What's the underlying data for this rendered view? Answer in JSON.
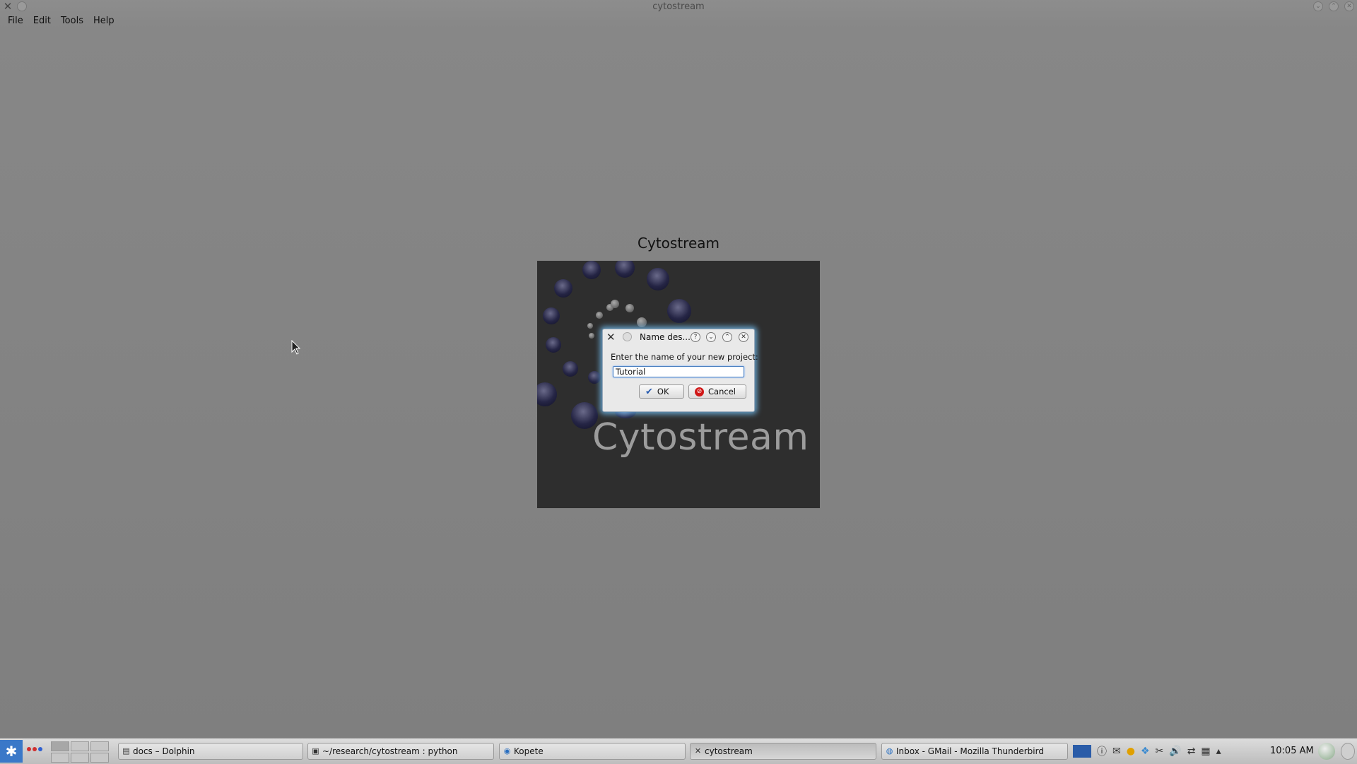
{
  "window": {
    "title": "cytostream"
  },
  "menu": {
    "items": [
      "File",
      "Edit",
      "Tools",
      "Help"
    ]
  },
  "splash": {
    "heading": "Cytostream",
    "logo_text": "Cytostream"
  },
  "dialog": {
    "title": "Name des...",
    "prompt": "Enter the name of your new project:",
    "input_value": "Tutorial",
    "ok_label": "OK",
    "cancel_label": "Cancel"
  },
  "taskbar": {
    "tasks": [
      {
        "label": "docs – Dolphin"
      },
      {
        "label": "~/research/cytostream : python"
      },
      {
        "label": "Kopete"
      },
      {
        "label": "cytostream"
      },
      {
        "label": "Inbox - GMail - Mozilla Thunderbird"
      }
    ],
    "clock": "10:05 AM"
  },
  "colors": {
    "accent": "#3a78c8",
    "dialog_glow": "#78c8ff",
    "cancel_red": "#d01818"
  }
}
